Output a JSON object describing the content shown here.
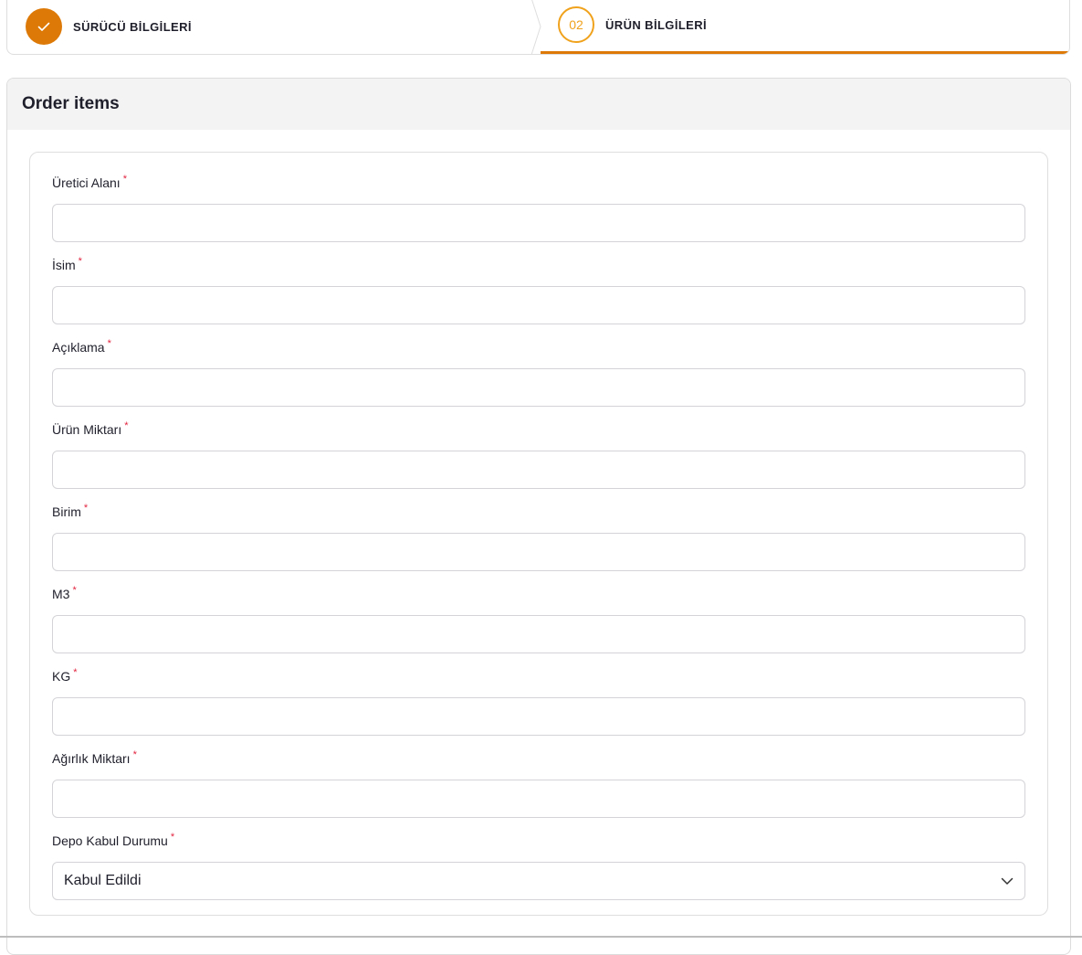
{
  "stepper": {
    "steps": [
      {
        "label": "SÜRÜCÜ BİLGİLERİ",
        "state": "completed",
        "icon": "check-icon"
      },
      {
        "label": "ÜRÜN BİLGİLERİ",
        "number": "02",
        "state": "current"
      }
    ],
    "accent_color": "#dd7a07",
    "current_color": "#f0a21c"
  },
  "card": {
    "title": "Order items"
  },
  "form": {
    "fields": [
      {
        "label": "Üretici Alanı",
        "required_mark": "*",
        "value": ""
      },
      {
        "label": "İsim",
        "required_mark": "*",
        "value": ""
      },
      {
        "label": "Açıklama",
        "required_mark": "*",
        "value": ""
      },
      {
        "label": "Ürün Miktarı",
        "required_mark": "*",
        "value": ""
      },
      {
        "label": "Birim",
        "required_mark": "*",
        "value": ""
      },
      {
        "label": "M3",
        "required_mark": "*",
        "value": ""
      },
      {
        "label": "KG",
        "required_mark": "*",
        "value": ""
      },
      {
        "label": "Ağırlık Miktarı",
        "required_mark": "*",
        "value": ""
      }
    ],
    "status_select": {
      "label": "Depo Kabul Durumu",
      "required_mark": "*",
      "selected": "Kabul Edildi",
      "icon": "chevron-down-icon"
    },
    "required_color": "#e2243f"
  }
}
